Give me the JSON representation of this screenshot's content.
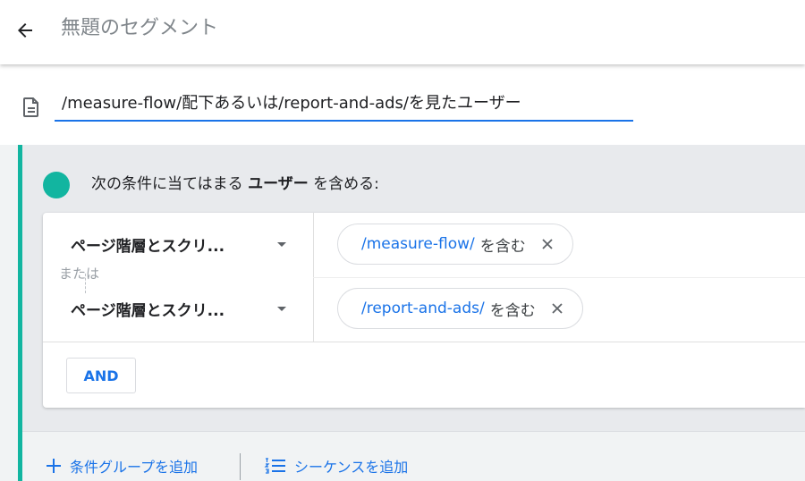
{
  "header": {
    "title": "無題のセグメント",
    "back_icon": "arrow-left-icon"
  },
  "segment_name": {
    "value": "/measure-flow/配下あるいは/report-and-ads/を見たユーザー",
    "icon": "document-icon"
  },
  "condition_group": {
    "prefix": "次の条件に当てはまる",
    "scope": "ユーザー",
    "suffix": "を含める:",
    "or_label": "または",
    "rows": [
      {
        "dimension": "ページ階層とスクリ...",
        "value": "/measure-flow/",
        "operator": "を含む"
      },
      {
        "dimension": "ページ階層とスクリ...",
        "value": "/report-and-ads/",
        "operator": "を含む"
      }
    ],
    "and_button": "AND"
  },
  "footer": {
    "add_group": "条件グループを追加",
    "add_sequence": "シーケンスを追加"
  },
  "colors": {
    "accent": "#12b5a0",
    "link": "#1a73e8"
  }
}
